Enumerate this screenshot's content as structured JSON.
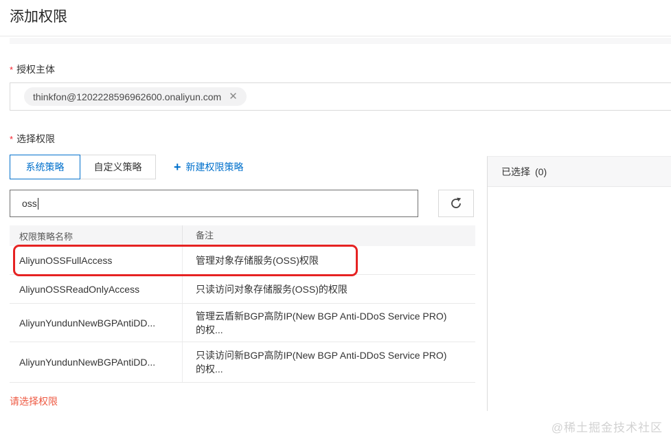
{
  "page": {
    "title": "添加权限",
    "watermark": "@稀土掘金技术社区"
  },
  "authorization": {
    "required_mark": "*",
    "label": "授权主体",
    "tag": {
      "text": "thinkfon@1202228596962600.onaliyun.com",
      "remove_icon": "✕"
    }
  },
  "permission": {
    "required_mark": "*",
    "label": "选择权限",
    "tabs": [
      {
        "label": "系统策略"
      },
      {
        "label": "自定义策略"
      }
    ],
    "create_link": {
      "plus": "+",
      "label": "新建权限策略"
    },
    "search": {
      "value": "oss"
    },
    "table": {
      "columns": [
        "权限策略名称",
        "备注"
      ],
      "rows": [
        {
          "name": "AliyunOSSFullAccess",
          "remark1": "管理对象存储服务(OSS)权限",
          "remark2": "",
          "highlighted": true
        },
        {
          "name": "AliyunOSSReadOnlyAccess",
          "remark1": "只读访问对象存储服务(OSS)的权限",
          "remark2": "",
          "highlighted": false
        },
        {
          "name": "AliyunYundunNewBGPAntiDD...",
          "remark1": "管理云盾新BGP高防IP(New BGP Anti-DDoS Service PRO)",
          "remark2": "的权...",
          "highlighted": false
        },
        {
          "name": "AliyunYundunNewBGPAntiDD...",
          "remark1": "只读访问新BGP高防IP(New BGP Anti-DDoS Service PRO)",
          "remark2": "的权...",
          "highlighted": false
        }
      ]
    },
    "error_text": "请选择权限"
  },
  "selected_panel": {
    "title": "已选择",
    "count": "(0)"
  },
  "colors": {
    "accent_blue": "#0070cc",
    "highlight_red": "#e62222",
    "error_orange": "#ee5a43"
  }
}
